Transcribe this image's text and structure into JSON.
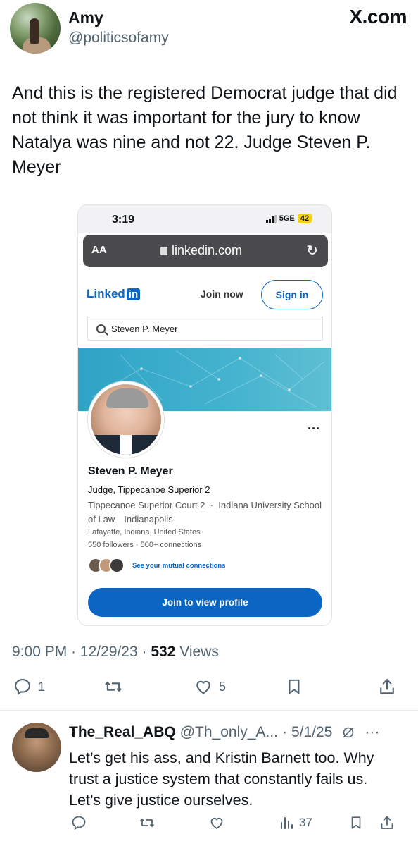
{
  "tweet": {
    "author_name": "Amy",
    "author_handle": "@politicsofamy",
    "brand": "X.com",
    "text": "And this is the registered Democrat judge that did not think it was important for the jury to know Natalya was nine and not 22. Judge Steven P. Meyer",
    "time": "9:00 PM",
    "date": "12/29/23",
    "views_count": "532",
    "views_label": "Views",
    "reply_count": "1",
    "like_count": "5"
  },
  "screenshot": {
    "status_time": "3:19",
    "network": "5GE",
    "battery": "42",
    "aa_label": "AA",
    "url": "linkedin.com",
    "linkedin": {
      "logo_text": "Linked",
      "logo_in": "in",
      "join_now": "Join now",
      "sign_in": "Sign in",
      "search_value": "Steven P. Meyer",
      "more": "...",
      "profile_name": "Steven P. Meyer",
      "headline": "Judge, Tippecanoe Superior 2",
      "work": "Tippecanoe Superior Court 2",
      "separator": "·",
      "education": "Indiana University School of Law—Indianapolis",
      "location": "Lafayette, Indiana, United States",
      "followers": "550 followers",
      "connections": "500+ connections",
      "mutual": "See your mutual connections",
      "join_button": "Join to view profile"
    }
  },
  "reply": {
    "name": "The_Real_ABQ",
    "handle": "@Th_only_A...",
    "date": "5/1/25",
    "more": "···",
    "text": "Let’s get his ass, and Kristin Barnett too. Why trust a justice system that constantly fails us. Let’s give justice ourselves.",
    "views_count": "37"
  },
  "icons": {
    "reply": "reply-icon",
    "retweet": "retweet-icon",
    "like": "heart-icon",
    "bookmark": "bookmark-icon",
    "share": "share-icon",
    "views": "analytics-icon",
    "grok": "grok-icon"
  },
  "colors": {
    "text": "#0f1419",
    "secondary": "#536471",
    "linkedin_blue": "#0a66c2",
    "banner": "#44b3cf"
  }
}
